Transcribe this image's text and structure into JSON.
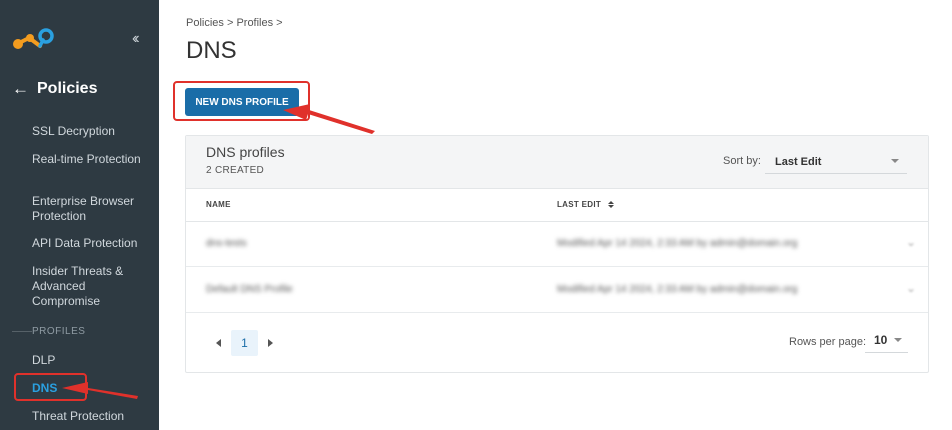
{
  "sidebar": {
    "collapse_icon": "double-chevron-left-icon",
    "section_title": "Policies",
    "items": [
      {
        "label": "SSL Decryption"
      },
      {
        "label": "Real-time Protection"
      },
      {
        "label": "Enterprise Browser Protection"
      },
      {
        "label": "API Data Protection"
      },
      {
        "label": "Insider Threats & Advanced Compromise"
      }
    ],
    "profiles_label": "PROFILES",
    "profile_items": [
      {
        "label": "DLP"
      },
      {
        "label": "DNS",
        "active": true
      },
      {
        "label": "Threat Protection"
      }
    ]
  },
  "breadcrumb": "Policies > Profiles >",
  "page_title": "DNS",
  "new_button": "NEW DNS PROFILE",
  "card": {
    "title": "DNS profiles",
    "count": "2 CREATED",
    "sort_label": "Sort by:",
    "sort_value": "Last Edit",
    "columns": {
      "name": "NAME",
      "last_edit": "LAST EDIT"
    },
    "rows": [
      {
        "name": "dns-tests",
        "last_edit": "Modified Apr 14 2024, 2:33 AM by admin@domain.org"
      },
      {
        "name": "Default DNS Profile",
        "last_edit": "Modified Apr 14 2024, 2:33 AM by admin@domain.org"
      }
    ],
    "page": "1",
    "rows_per_page_label": "Rows per page:",
    "rows_per_page": "10"
  },
  "colors": {
    "sidebar_bg": "#2e3a42",
    "accent": "#1a6da8",
    "active_nav": "#2aa0e0",
    "annotation": "#e0312b"
  }
}
